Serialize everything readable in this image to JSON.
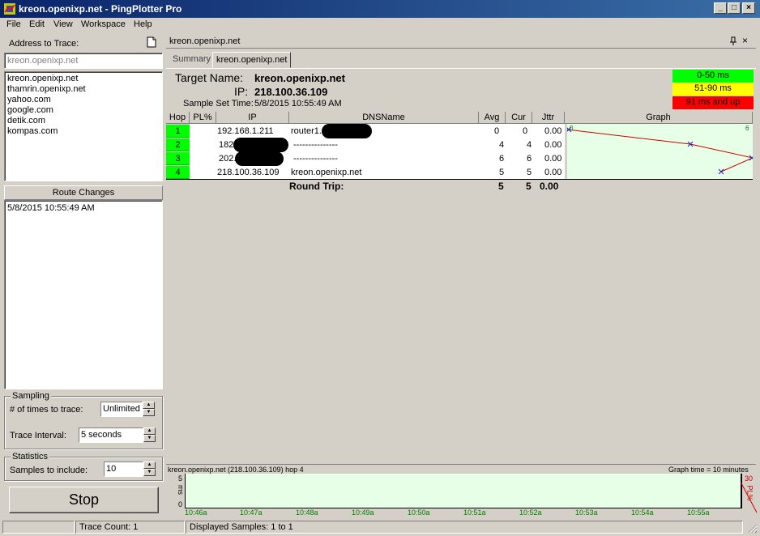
{
  "window": {
    "title": "kreon.openixp.net - PingPlotter Pro",
    "buttons": {
      "minimize": "_",
      "maximize": "□",
      "close": "×"
    }
  },
  "menu": [
    "File",
    "Edit",
    "View",
    "Workspace",
    "Help"
  ],
  "left": {
    "address_label": "Address to Trace:",
    "address_value": "kreon.openixp.net",
    "history": [
      "kreon.openixp.net",
      "thamrin.openixp.net",
      "yahoo.com",
      "google.com",
      "detik.com",
      "kompas.com"
    ],
    "route_changes_title": "Route Changes",
    "route_changes": [
      "5/8/2015 10:55:49 AM"
    ],
    "sampling": {
      "title": "Sampling",
      "times_label": "# of times to trace:",
      "times_value": "Unlimited",
      "interval_label": "Trace Interval:",
      "interval_value": "5 seconds"
    },
    "statistics": {
      "title": "Statistics",
      "samples_label": "Samples to include:",
      "samples_value": "10"
    },
    "stop_label": "Stop"
  },
  "doc": {
    "panel_title": "kreon.openixp.net",
    "tabs": [
      "Summary",
      "kreon.openixp.net"
    ],
    "target_name_label": "Target Name:",
    "target_name": "kreon.openixp.net",
    "ip_label": "IP:",
    "ip": "218.100.36.109",
    "sample_label": "Sample Set Time:",
    "sample_time": "5/8/2015 10:55:49 AM",
    "legend": [
      {
        "label": "0-50 ms",
        "color": "#00ff00",
        "text": "#000000"
      },
      {
        "label": "51-90 ms",
        "color": "#ffff00",
        "text": "#000000"
      },
      {
        "label": "91 ms and up",
        "color": "#ff0000",
        "text": "#000000"
      }
    ]
  },
  "table": {
    "headers": [
      "Hop",
      "PL%",
      "IP",
      "DNSName",
      "Avg",
      "Cur",
      "Jttr",
      "Graph"
    ],
    "rows": [
      {
        "hop": "1",
        "pl": "",
        "ip": "192.168.1.211",
        "dns": "router1.",
        "avg": "0",
        "cur": "0",
        "jttr": "0.00"
      },
      {
        "hop": "2",
        "pl": "",
        "ip": "182.",
        "dns": "---------------",
        "avg": "4",
        "cur": "4",
        "jttr": "0.00"
      },
      {
        "hop": "3",
        "pl": "",
        "ip": "202.",
        "dns": "---------------",
        "avg": "6",
        "cur": "6",
        "jttr": "0.00"
      },
      {
        "hop": "4",
        "pl": "",
        "ip": "218.100.36.109",
        "dns": "kreon.openixp.net",
        "avg": "5",
        "cur": "5",
        "jttr": "0.00"
      }
    ],
    "round_trip_label": "Round Trip:",
    "round_trip": {
      "avg": "5",
      "cur": "5",
      "jttr": "0.00"
    },
    "graph_scale": {
      "min": "0",
      "max": "6"
    }
  },
  "timeline": {
    "title": "kreon.openixp.net (218.100.36.109) hop 4",
    "graph_time": "Graph time = 10 minutes",
    "y_label": "ms",
    "y_ticks": [
      "5",
      "0"
    ],
    "pl_label": "PL%",
    "pl_ticks": [
      "30"
    ],
    "x_ticks": [
      "10:46a",
      "10:47a",
      "10:48a",
      "10:49a",
      "10:50a",
      "10:51a",
      "10:52a",
      "10:53a",
      "10:54a",
      "10:55a"
    ]
  },
  "status": {
    "trace_count": "Trace Count: 1",
    "displayed": "Displayed Samples: 1 to 1"
  }
}
